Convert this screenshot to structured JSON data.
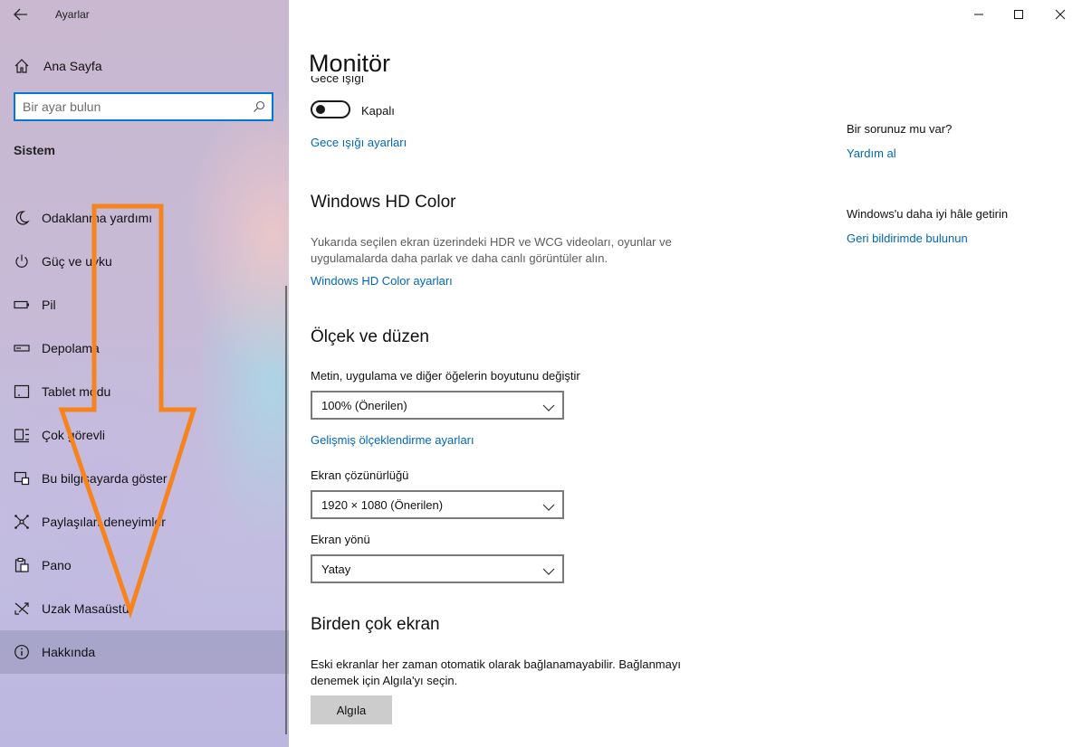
{
  "window": {
    "app_title": "Ayarlar",
    "back_icon": "back-arrow-icon",
    "controls": [
      "minimize-icon",
      "maximize-icon",
      "close-icon"
    ]
  },
  "sidebar": {
    "home_label": "Ana Sayfa",
    "search_placeholder": "Bir ayar bulun",
    "section_title": "Sistem",
    "items": [
      {
        "label": "Odaklanma yardımı",
        "icon": "moon-icon"
      },
      {
        "label": "Güç ve uyku",
        "icon": "power-icon"
      },
      {
        "label": "Pil",
        "icon": "battery-icon"
      },
      {
        "label": "Depolama",
        "icon": "storage-icon"
      },
      {
        "label": "Tablet modu",
        "icon": "tablet-icon"
      },
      {
        "label": "Çok görevli",
        "icon": "multitasking-icon"
      },
      {
        "label": "Bu bilgisayarda göster",
        "icon": "project-icon"
      },
      {
        "label": "Paylaşılan deneyimler",
        "icon": "shared-experiences-icon"
      },
      {
        "label": "Pano",
        "icon": "clipboard-icon"
      },
      {
        "label": "Uzak Masaüstü",
        "icon": "remote-desktop-icon"
      },
      {
        "label": "Hakkında",
        "icon": "info-icon",
        "selected": true
      }
    ],
    "overlay_arrow_color": "#f7831e"
  },
  "main": {
    "title": "Monitör",
    "night_light_label": "Gece ışığı",
    "night_light_state": "Kapalı",
    "night_light_link": "Gece ışığı ayarları",
    "hdr": {
      "heading": "Windows HD Color",
      "description": "Yukarıda seçilen ekran üzerindeki HDR ve WCG videoları, oyunlar ve uygulamalarda daha parlak ve daha canlı görüntüler alın.",
      "link": "Windows HD Color ayarları"
    },
    "scale": {
      "heading": "Ölçek ve düzen",
      "size_label": "Metin, uygulama ve diğer öğelerin boyutunu değiştir",
      "size_value": "100% (Önerilen)",
      "advanced_link": "Gelişmiş ölçeklendirme ayarları",
      "resolution_label": "Ekran çözünürlüğü",
      "resolution_value": "1920 × 1080 (Önerilen)",
      "orientation_label": "Ekran yönü",
      "orientation_value": "Yatay"
    },
    "multi": {
      "heading": "Birden çok ekran",
      "description": "Eski ekranlar her zaman otomatik olarak bağlanamayabilir. Bağlanmayı denemek için Algıla'yı seçin.",
      "detect_button": "Algıla"
    }
  },
  "help_panel": {
    "question": "Bir sorunuz mu var?",
    "help_link": "Yardım al",
    "improve_text": "Windows'u daha iyi hâle getirin",
    "feedback_link": "Geri bildirimde bulunun"
  },
  "colors": {
    "accent": "#0078d7",
    "link": "#0067b8"
  }
}
